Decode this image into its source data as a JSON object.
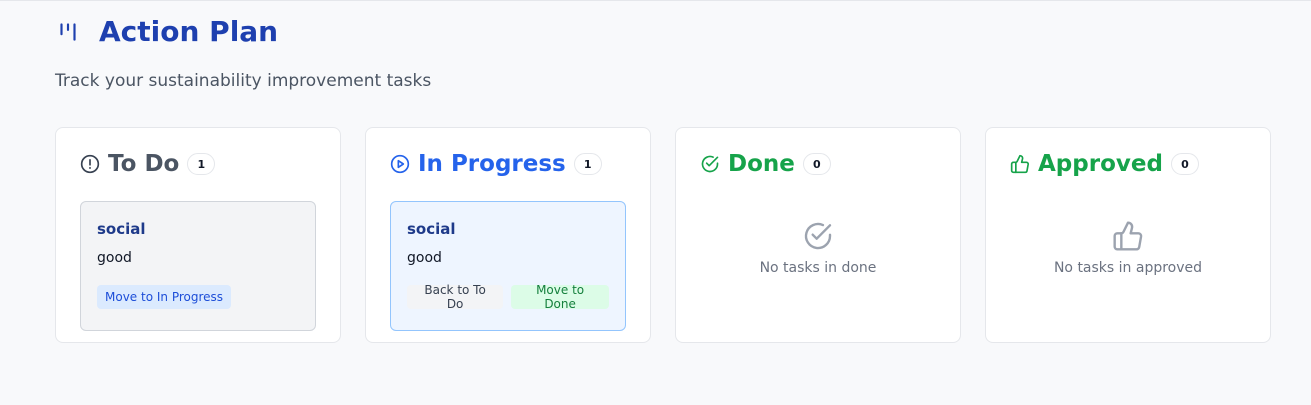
{
  "page": {
    "title": "Action Plan",
    "subtitle": "Track your sustainability improvement tasks",
    "icon": "kanban-icon"
  },
  "colors": {
    "primary": "#1e40af",
    "in_progress": "#2563eb",
    "done": "#16a34a",
    "approved": "#16a34a",
    "todo": "#4b5563"
  },
  "columns": {
    "todo": {
      "title": "To Do",
      "count": "1",
      "icon": "alert-circle-icon",
      "cards": [
        {
          "title": "social",
          "description": "good",
          "actions": [
            "Move to In Progress"
          ]
        }
      ]
    },
    "in_progress": {
      "title": "In Progress",
      "count": "1",
      "icon": "play-circle-icon",
      "cards": [
        {
          "title": "social",
          "description": "good",
          "actions": [
            "Back to To Do",
            "Move to Done"
          ]
        }
      ]
    },
    "done": {
      "title": "Done",
      "count": "0",
      "icon": "check-circle-icon",
      "empty_text": "No tasks in done",
      "empty_icon": "check-circle-icon"
    },
    "approved": {
      "title": "Approved",
      "count": "0",
      "icon": "thumbs-up-icon",
      "empty_text": "No tasks in approved",
      "empty_icon": "thumbs-up-icon"
    }
  }
}
